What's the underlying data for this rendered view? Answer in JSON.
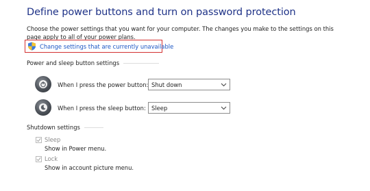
{
  "page": {
    "title": "Define power buttons and turn on password protection",
    "description": "Choose the power settings that you want for your computer. The changes you make to the settings on this page apply to all of your power plans.",
    "change_link": "Change settings that are currently unavailable"
  },
  "power_sleep": {
    "header": "Power and sleep button settings",
    "power_button": {
      "label": "When I press the power button:",
      "value": "Shut down",
      "icon": "power-button-icon"
    },
    "sleep_button": {
      "label": "When I press the sleep button:",
      "value": "Sleep",
      "icon": "sleep-button-icon"
    }
  },
  "shutdown": {
    "header": "Shutdown settings",
    "options": [
      {
        "label": "Sleep",
        "description": "Show in Power menu.",
        "checked": true,
        "enabled": false
      },
      {
        "label": "Lock",
        "description": "Show in account picture menu.",
        "checked": true,
        "enabled": false
      }
    ]
  },
  "colors": {
    "title": "#1e3287",
    "link": "#1a56c4",
    "highlight_border": "#d32f2f",
    "disabled_text": "#8a8a8a"
  }
}
